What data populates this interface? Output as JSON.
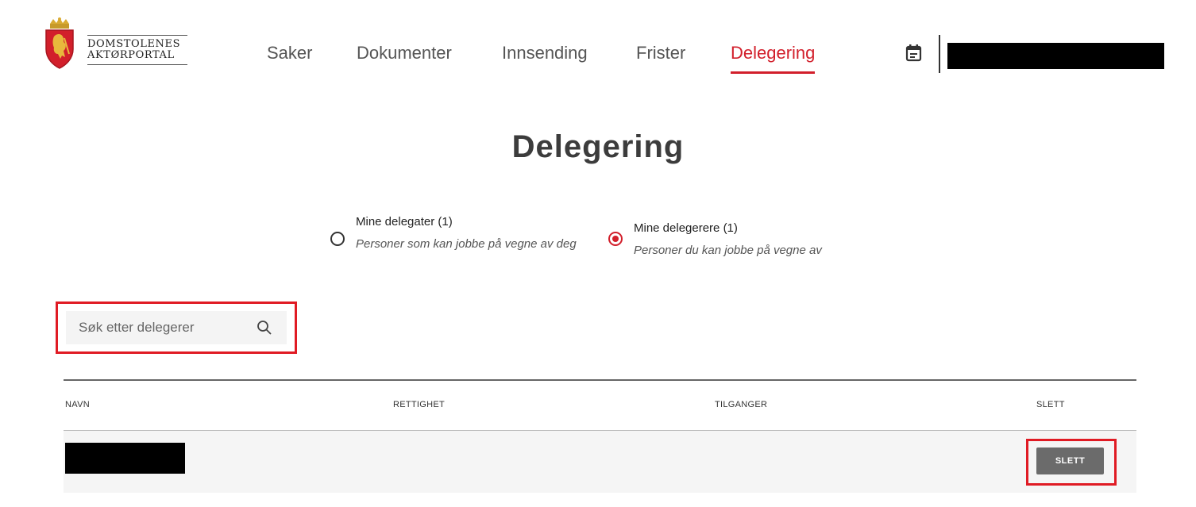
{
  "header": {
    "brand_line1": "DOMSTOLENES",
    "brand_line2": "AKTØRPORTAL",
    "nav": [
      {
        "label": "Saker",
        "active": false
      },
      {
        "label": "Dokumenter",
        "active": false
      },
      {
        "label": "Innsending",
        "active": false
      },
      {
        "label": "Frister",
        "active": false
      },
      {
        "label": "Delegering",
        "active": true
      }
    ],
    "calendar_icon": "calendar-icon"
  },
  "page": {
    "title": "Delegering"
  },
  "tabs": [
    {
      "title": "Mine delegater (1)",
      "description": "Personer som kan jobbe på vegne av deg",
      "selected": false
    },
    {
      "title": "Mine delegerere (1)",
      "description": "Personer du kan jobbe på vegne av",
      "selected": true
    }
  ],
  "search": {
    "placeholder": "Søk etter delegerer",
    "value": "",
    "icon": "search-icon"
  },
  "table": {
    "columns": [
      "NAVN",
      "RETTIGHET",
      "TILGANGER",
      "SLETT"
    ],
    "rows": [
      {
        "rettighet": "",
        "tilganger": "",
        "action_label": "SLETT"
      }
    ]
  },
  "colors": {
    "accent": "#d21f2b",
    "highlight": "#e01b24",
    "button": "#6b6b6b"
  }
}
